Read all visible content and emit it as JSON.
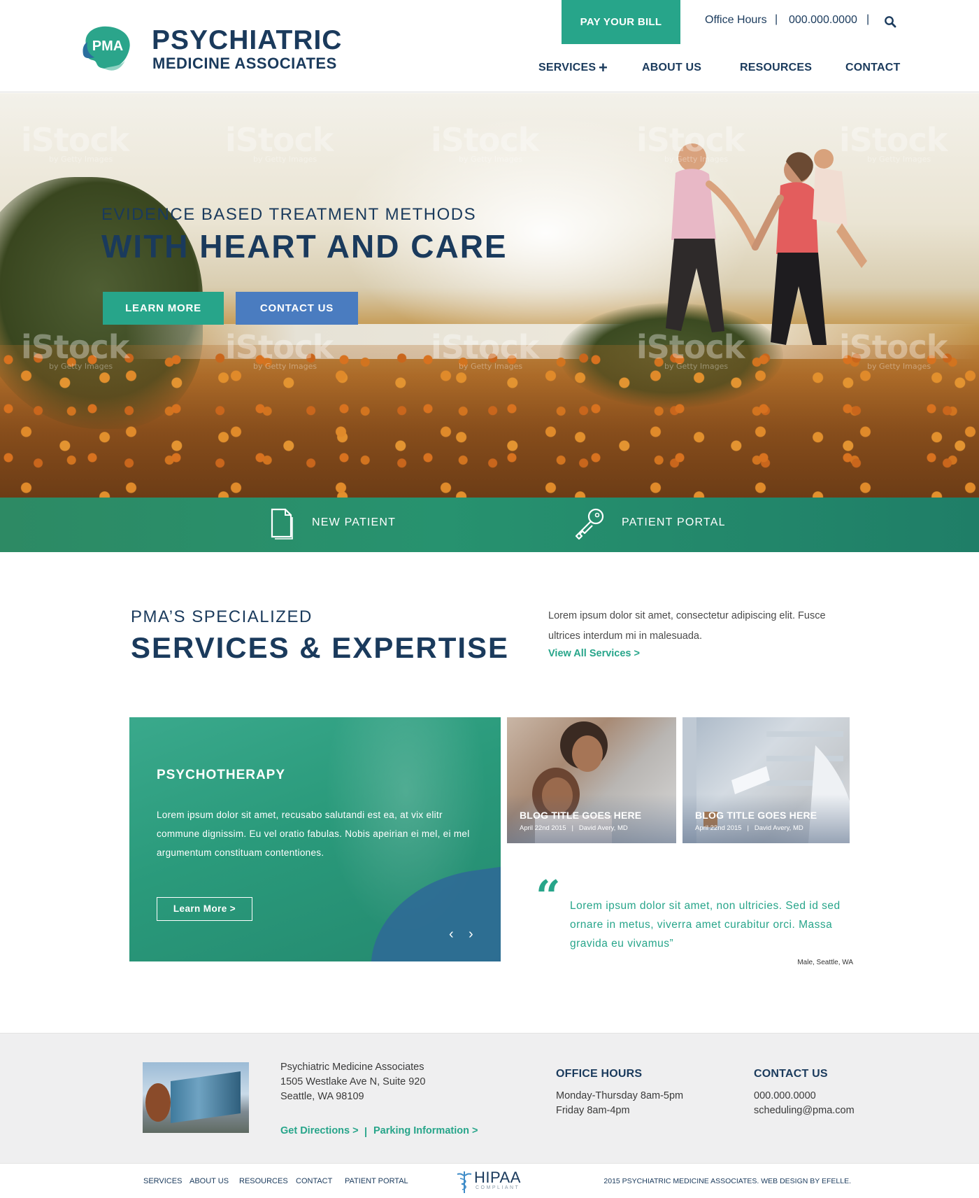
{
  "header": {
    "logo": {
      "mark_text": "PMA",
      "line1": "PSYCHIATRIC",
      "line2": "MEDICINE ASSOCIATES"
    },
    "pay_bill_label": "PAY YOUR BILL",
    "office_hours_label": "Office Hours",
    "phone": "000.000.0000",
    "separator": "|",
    "search_icon": "search-icon",
    "nav": [
      {
        "label": "SERVICES"
      },
      {
        "label": "ABOUT US"
      },
      {
        "label": "RESOURCES"
      },
      {
        "label": "CONTACT"
      }
    ],
    "services_expand_symbol": "+"
  },
  "hero": {
    "subtitle": "EVIDENCE BASED TREATMENT METHODS",
    "title": "WITH HEART AND CARE",
    "learn_more_label": "LEARN MORE",
    "contact_us_label": "CONTACT US",
    "watermark_brand": "iStock",
    "watermark_sub": "by Getty Images"
  },
  "quick_links": [
    {
      "label": "NEW PATIENT",
      "icon": "document-icon"
    },
    {
      "label": "PATIENT PORTAL",
      "icon": "key-icon"
    }
  ],
  "services": {
    "subtitle": "PMA’S SPECIALIZED",
    "title": "SERVICES & EXPERTISE",
    "description": "Lorem ipsum dolor sit amet, consectetur adipiscing elit. Fusce ultrices interdum mi in malesuada.",
    "view_all_label": "View All Services >"
  },
  "feature": {
    "title": "PSYCHOTHERAPY",
    "text": "Lorem ipsum dolor sit amet, recusabo salutandi est ea, at vix elitr commune dignissim. Eu vel oratio fabulas. Nobis apeirian ei mel, ei mel argumentum constituam contentiones.",
    "button_label": "Learn More >",
    "prev_symbol": "‹",
    "next_symbol": "›"
  },
  "blogs": [
    {
      "title": "BLOG TITLE GOES HERE",
      "date": "April 22nd 2015",
      "author": "David Avery, MD"
    },
    {
      "title": "BLOG TITLE GOES HERE",
      "date": "April 22nd 2015",
      "author": "David Avery, MD"
    }
  ],
  "testimonial": {
    "quote_mark": "“",
    "text": "Lorem ipsum dolor sit amet, non ultricies. Sed id sed ornare in metus, viverra amet curabitur orci. Massa gravida eu vivamus”",
    "author": "Male, Seattle, WA"
  },
  "footer": {
    "address": {
      "name": "Psychiatric Medicine Associates",
      "street": "1505 Westlake Ave N, Suite 920",
      "city": "Seattle, WA 98109"
    },
    "directions_label": "Get Directions >",
    "link_separator": "|",
    "parking_label": "Parking Information >",
    "hours": {
      "heading": "OFFICE HOURS",
      "line1": "Monday-Thursday 8am-5pm",
      "line2": "Friday 8am-4pm"
    },
    "contact": {
      "heading": "CONTACT US",
      "phone": "000.000.0000",
      "email": "scheduling@pma.com"
    },
    "bottom_nav": [
      {
        "label": "SERVICES"
      },
      {
        "label": "ABOUT US"
      },
      {
        "label": "RESOURCES"
      },
      {
        "label": "CONTACT"
      },
      {
        "label": "PATIENT PORTAL"
      }
    ],
    "hipaa_label": "HIPAA",
    "hipaa_sub": "COMPLIANT",
    "copyright": "2015 PSYCHIATRIC MEDICINE ASSOCIATES. WEB DESIGN BY EFELLE."
  },
  "colors": {
    "brand_navy": "#1a3a5c",
    "brand_teal": "#27a58a",
    "accent_blue": "#4a7cc0"
  }
}
